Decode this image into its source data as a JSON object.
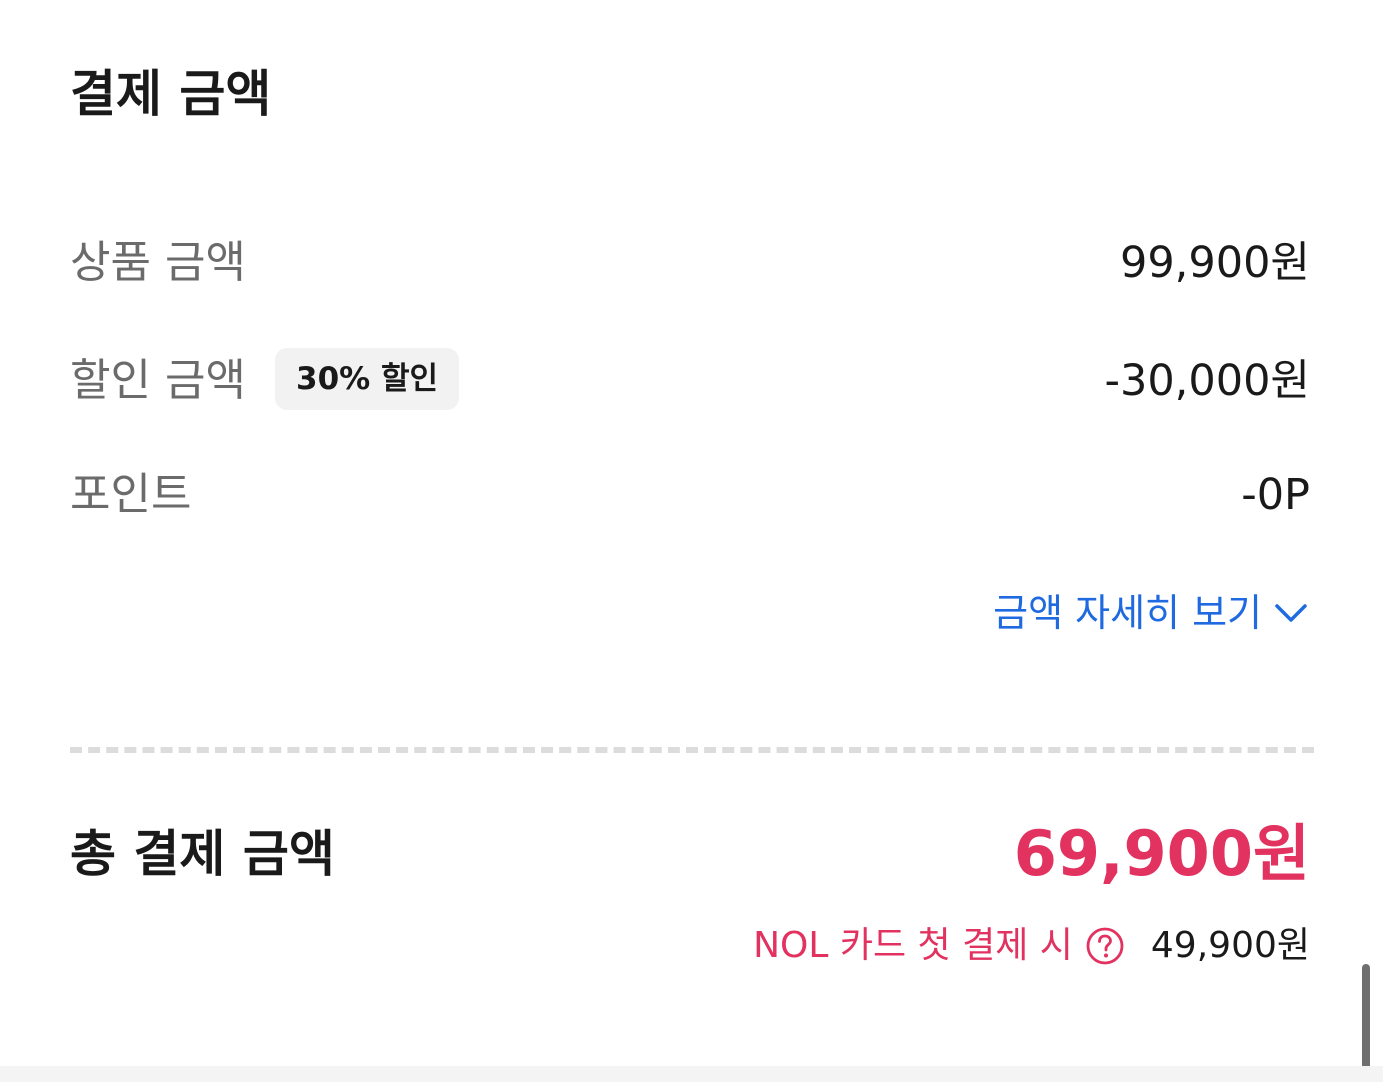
{
  "section": {
    "title": "결제 금액"
  },
  "rows": [
    {
      "label": "상품 금액",
      "value": "99,900원"
    },
    {
      "label": "할인 금액",
      "badge": "30% 할인",
      "value": "-30,000원"
    },
    {
      "label": "포인트",
      "value": "-0P"
    }
  ],
  "detail_link": {
    "label": "금액 자세히 보기",
    "icon": "chevron-down-icon"
  },
  "total": {
    "label": "총 결제 금액",
    "value": "69,900원"
  },
  "promo": {
    "label": "NOL 카드 첫 결제 시",
    "icon": "help-circle-icon",
    "price": "49,900원"
  },
  "colors": {
    "accent": "#e2325f",
    "link": "#1f6ae0",
    "muted": "#6b6b6b",
    "text": "#1a1a1a",
    "badge_bg": "#f2f2f2"
  }
}
